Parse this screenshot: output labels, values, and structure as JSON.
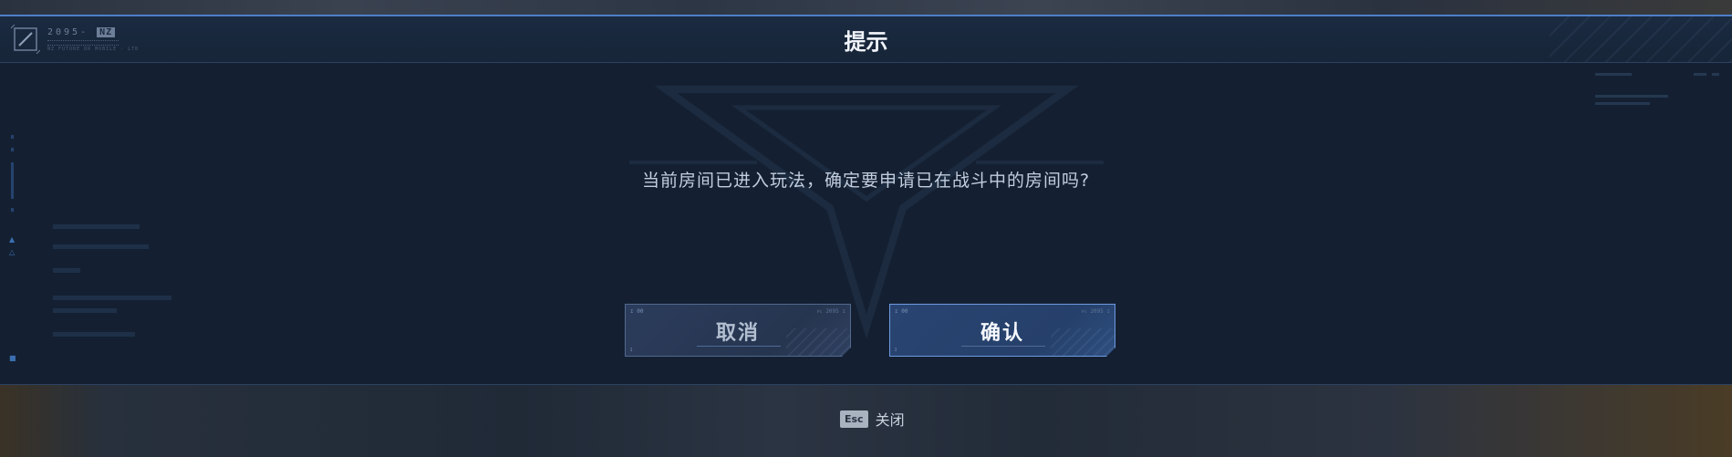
{
  "dialog": {
    "title": "提示",
    "message": "当前房间已进入玩法，确定要申请已在战斗中的房间吗?",
    "brand_code": "2095-",
    "brand_tag": "NZ",
    "brand_sub": "NZ FUTURE DR MOBILE · LTD"
  },
  "buttons": {
    "cancel_label": "取消",
    "confirm_label": "确认",
    "corner_tl": "ɪ 00",
    "corner_tr": "ꜰᴄ 2095 ɪ"
  },
  "footer": {
    "esc_key": "Esc",
    "esc_label": "关闭"
  },
  "colors": {
    "accent": "#4d7fc8",
    "panel": "#142032",
    "confirm_border": "#6d9be0"
  },
  "icons": [
    "logo-icon",
    "emblem-icon"
  ]
}
